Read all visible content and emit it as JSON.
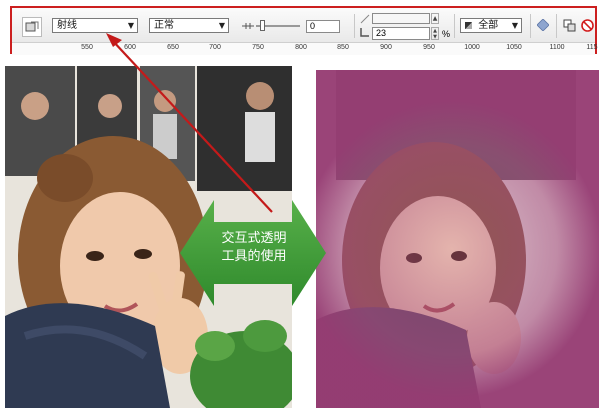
{
  "toolbar": {
    "mode_select": "射线",
    "merge_select": "正常",
    "edge_value": "0",
    "angle_value": "23",
    "percent": "%",
    "target_select": "全部"
  },
  "ruler": {
    "ticks": [
      "550",
      "600",
      "650",
      "700",
      "750",
      "800",
      "850",
      "900",
      "950",
      "1000",
      "1050",
      "1100",
      "115"
    ]
  },
  "caption": {
    "line1": "交互式透明",
    "line2": "工具的使用"
  },
  "colors": {
    "highlight_border": "#cc1f1f",
    "arrow_green": "#3e9a36",
    "overlay_pink": "#a4467a"
  }
}
